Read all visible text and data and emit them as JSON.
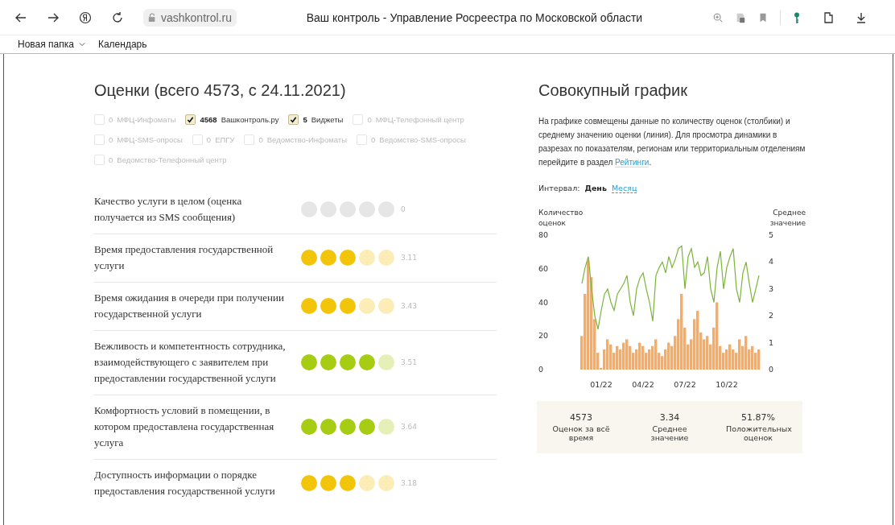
{
  "browser": {
    "address": "vashkontrol.ru",
    "title": "Ваш контроль - Управление Росреестра по Московской области",
    "bookmarks": [
      {
        "label": "Новая папка",
        "kind": "folder"
      },
      {
        "label": "Календарь",
        "kind": "link"
      }
    ]
  },
  "ratings": {
    "title": "Оценки (всего 4573, с 24.11.2021)",
    "sources": [
      {
        "count": "0",
        "label": "МФЦ-Инфоматы",
        "checked": false
      },
      {
        "count": "4568",
        "label": "Вашконтроль.ру",
        "checked": true
      },
      {
        "count": "5",
        "label": "Виджеты",
        "checked": true
      },
      {
        "count": "0",
        "label": "МФЦ-Телефонный центр",
        "checked": false
      },
      {
        "count": "0",
        "label": "МФЦ-SMS-опросы",
        "checked": false
      },
      {
        "count": "0",
        "label": "ЕПГУ",
        "checked": false
      },
      {
        "count": "0",
        "label": "Ведомство-Инфоматы",
        "checked": false
      },
      {
        "count": "0",
        "label": "Ведомство-SMS-опросы",
        "checked": false
      },
      {
        "count": "0",
        "label": "Ведомство-Телефонный центр",
        "checked": false
      }
    ],
    "criteria": [
      {
        "label": "Качество услуги в целом (оценка получается из SMS сообщения)",
        "stars": 0,
        "color": "#e6e6e6",
        "score": "0"
      },
      {
        "label": "Время предоставления государственной услуги",
        "stars": 3,
        "color": "#f2c40a",
        "score": "3.11"
      },
      {
        "label": "Время ожидания в очереди при получении государственной услуги",
        "stars": 3,
        "color": "#f2c40a",
        "score": "3.43"
      },
      {
        "label": "Вежливость и компетентность сотрудника, взаимодействующего с заявителем при предоставлении государственной услуги",
        "stars": 4,
        "color": "#a6cc14",
        "score": "3.51"
      },
      {
        "label": "Комфортность условий в помещении, в котором предоставлена государственная услуга",
        "stars": 4,
        "color": "#a6cc14",
        "score": "3.64"
      },
      {
        "label": "Доступность информации о порядке предоставления государственной услуги",
        "stars": 3,
        "color": "#f2c40a",
        "score": "3.18"
      }
    ]
  },
  "summary": {
    "title": "Совокупный график",
    "description_before": "На графике совмещены данные по количеству оценок (столбики) и среднему значению оценки (линия). Для просмотра динамики в разрезах по показателям, регионам или территориальным отделениям перейдите в раздел ",
    "link": "Рейтинги",
    "description_after": ".",
    "interval_label": "Интервал:",
    "intervals": [
      {
        "label": "День",
        "selected": true
      },
      {
        "label": "Месяц",
        "selected": false
      }
    ],
    "count_chart": {
      "chart_data": {
        "type": "bar",
        "categories": [
          null,
          null,
          null,
          null,
          null,
          null,
          "01/22",
          null,
          null,
          null,
          null,
          null,
          null,
          null,
          null,
          null,
          null,
          null,
          null,
          "04/22",
          null,
          null,
          null,
          null,
          null,
          null,
          null,
          null,
          null,
          null,
          null,
          null,
          "07/22",
          null,
          null,
          null,
          null,
          null,
          null,
          null,
          null,
          null,
          null,
          null,
          null,
          "10/22",
          null,
          null,
          null,
          null,
          null,
          null,
          null,
          null,
          null,
          null
        ],
        "ylim": [
          0,
          80
        ],
        "yticks": [
          {
            "value": 0,
            "label": "0"
          },
          {
            "value": 20,
            "label": "20"
          },
          {
            "value": 40,
            "label": "40"
          },
          {
            "value": 60,
            "label": "60"
          },
          {
            "value": 80,
            "label": "80"
          }
        ],
        "series": [
          {
            "name": "Количество оценок",
            "color": "#fbaa62",
            "values": [
              20,
              45,
              65,
              55,
              30,
              10,
              1,
              12,
              18,
              15,
              10,
              14,
              12,
              16,
              18,
              14,
              10,
              12,
              16,
              14,
              10,
              12,
              14,
              18,
              10,
              8,
              12,
              16,
              14,
              20,
              30,
              45,
              25,
              15,
              18,
              30,
              35,
              22,
              18,
              20,
              15,
              25,
              40,
              14,
              10,
              12,
              15,
              12,
              10,
              18,
              14,
              20,
              12,
              14,
              10,
              12
            ]
          }
        ]
      }
    },
    "average_chart": {
      "chart_data": {
        "type": "line",
        "ylim": [
          0,
          5
        ],
        "yticks": [
          {
            "value": 0,
            "label": "0"
          },
          {
            "value": 1,
            "label": "1"
          },
          {
            "value": 2,
            "label": "2"
          },
          {
            "value": 3,
            "label": "3"
          },
          {
            "value": 4,
            "label": "4"
          },
          {
            "value": 5,
            "label": "5"
          }
        ],
        "series": [
          {
            "name": "Среднее значение",
            "color": "#7ab53a",
            "values": [
              3.2,
              3.8,
              4.2,
              3.0,
              2.0,
              1.5,
              2.2,
              2.8,
              3.0,
              2.5,
              2.2,
              2.8,
              3.0,
              3.2,
              3.5,
              2.5,
              2.0,
              3.0,
              3.4,
              3.6,
              3.0,
              2.5,
              1.8,
              3.5,
              3.8,
              4.0,
              3.6,
              4.2,
              3.8,
              4.1,
              4.5,
              4.6,
              3.0,
              4.2,
              4.5,
              3.8,
              4.0,
              3.5,
              3.6,
              4.2,
              3.0,
              2.5,
              3.8,
              4.4,
              3.0,
              3.8,
              4.2,
              4.5,
              3.0,
              2.5,
              3.6,
              4.0,
              3.2,
              2.5,
              3.0,
              3.5
            ]
          }
        ]
      }
    },
    "stats": [
      {
        "value": "4573",
        "label": "Оценок за всё время"
      },
      {
        "value": "3.34",
        "label": "Среднее значение"
      },
      {
        "value": "51.87%",
        "label": "Положительных оценок"
      }
    ]
  }
}
